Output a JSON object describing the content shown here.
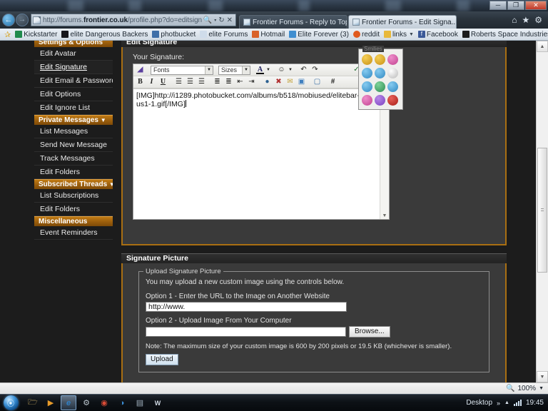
{
  "window": {
    "minimize": "─",
    "restore": "❐",
    "close": "✕"
  },
  "browser": {
    "back_icon": "←",
    "forward_icon": "→",
    "address": {
      "scheme": "http://forums.",
      "domain": "frontier.co.uk",
      "path": "/profile.php?do=editsignature",
      "search_icon": "🔍",
      "dropdown_icon": "▾",
      "refresh_icon": "↻",
      "stop_icon": "✕"
    },
    "tabs": [
      {
        "title": "Frontier Forums - Reply to Topic",
        "active": false
      },
      {
        "title": "Frontier Forums - Edit Signa...",
        "active": true,
        "close": "✕"
      }
    ],
    "toolbar_right": {
      "home_icon": "⌂",
      "favorites_icon": "★",
      "tools_icon": "⚙"
    },
    "bookmarks": [
      {
        "label": "Kickstarter",
        "icon_color": "#1f8a4c",
        "glyph": "K"
      },
      {
        "label": "elite Dangerous Backers",
        "icon_color": "#16161b",
        "glyph": "▼"
      },
      {
        "label": "photbucket",
        "icon_color": "#3f6fa8",
        "glyph": "▣"
      },
      {
        "label": "elite Forums",
        "icon_color": "#cfdcea",
        "glyph": "◨"
      },
      {
        "label": "Hotmail",
        "icon_color": "#d9622a",
        "glyph": "✉"
      },
      {
        "label": "Elite Forever (3)",
        "icon_color": "#3f8ed0",
        "glyph": "e"
      },
      {
        "label": "reddit",
        "icon_color": "#e05a1e",
        "glyph": "◉"
      },
      {
        "label": "links",
        "icon_color": "#e8b93c",
        "glyph": "▮",
        "has_dropdown": true
      },
      {
        "label": "Facebook",
        "icon_color": "#3b5998",
        "glyph": "f"
      },
      {
        "label": "Roberts Space Industries",
        "icon_color": "#1c1c1c",
        "glyph": "▤"
      }
    ],
    "bookmarks_overflow": "»",
    "favorites_star": "✰"
  },
  "sidebar": {
    "groups": [
      {
        "header": "Settings & Options",
        "caret": "",
        "items": [
          {
            "label": "Edit Avatar",
            "selected": false
          },
          {
            "label": "Edit Signature",
            "selected": true
          },
          {
            "label": "Edit Email & Password",
            "selected": false
          },
          {
            "label": "Edit Options",
            "selected": false
          },
          {
            "label": "Edit Ignore List",
            "selected": false
          }
        ]
      },
      {
        "header": "Private Messages",
        "caret": "▼",
        "items": [
          {
            "label": "List Messages",
            "selected": false
          },
          {
            "label": "Send New Message",
            "selected": false
          },
          {
            "label": "Track Messages",
            "selected": false
          },
          {
            "label": "Edit Folders",
            "selected": false
          }
        ]
      },
      {
        "header": "Subscribed Threads",
        "caret": "▼",
        "items": [
          {
            "label": "List Subscriptions",
            "selected": false
          },
          {
            "label": "Edit Folders",
            "selected": false
          }
        ]
      },
      {
        "header": "Miscellaneous",
        "caret": "",
        "items": [
          {
            "label": "Event Reminders",
            "selected": false
          }
        ]
      }
    ]
  },
  "edit_signature": {
    "block_title": "Edit Signature",
    "label": "Your Signature:",
    "toolbar": {
      "removeformat_icon": "░",
      "fonts_value": "Fonts",
      "sizes_value": "Sizes",
      "fontcolor_letter": "A",
      "smiley_icon": "☺",
      "undo_icon": "↶",
      "redo_icon": "↷",
      "spellcheck_icon": "✓",
      "wrap_icon": "↕",
      "mode_icon": "◢",
      "bold": "B",
      "italic": "I",
      "underline": "U",
      "align_left": "≡",
      "align_center": "≡",
      "align_right": "≡",
      "list_ordered": "≣",
      "list_unordered": "≣",
      "outdent": "⇤",
      "indent": "⇥",
      "link_icon": "🌐",
      "unlink_icon": "✂",
      "email_icon": "✉",
      "image_icon": "🖼",
      "quote_icon": "💬",
      "code_icon": "#",
      "dropdown_arrow": "▾"
    },
    "content": "[IMG]http://i1289.photobucket.com/albums/b518/mobiused/elitebar-mobius1-1.gif[/IMG]",
    "scroll_up": "▲",
    "scroll_down": "▼",
    "smilies": {
      "legend": "Smilies",
      "items": [
        {
          "face": ":)",
          "color1": "#f5cf55",
          "color2": "#c89014"
        },
        {
          "face": ":D",
          "color1": "#f5cf55",
          "color2": "#c89014"
        },
        {
          "face": ":p",
          "color1": "#ee8ecb",
          "color2": "#c2418f"
        },
        {
          "face": ":(",
          "color1": "#86cbf0",
          "color2": "#2f88c2"
        },
        {
          "face": "B)",
          "color1": "#86cbf0",
          "color2": "#2f88c2"
        },
        {
          "face": ":O",
          "color1": "#f0f0f0",
          "color2": "#b8b8b8"
        },
        {
          "face": ";)",
          "color1": "#86cbf0",
          "color2": "#2f88c2"
        },
        {
          "face": ":#",
          "color1": "#7ed39a",
          "color2": "#2d8c52"
        },
        {
          "face": "zz",
          "color1": "#86cbf0",
          "color2": "#2f88c2"
        },
        {
          "face": ">:",
          "color1": "#ee8ecb",
          "color2": "#c2418f"
        },
        {
          "face": ":x",
          "color1": "#b88ae8",
          "color2": "#7a3fc0"
        },
        {
          "face": ":@",
          "color1": "#e8625a",
          "color2": "#a81c16"
        }
      ]
    }
  },
  "signature_picture": {
    "block_title": "Signature Picture",
    "legend": "Upload Signature Picture",
    "intro": "You may upload a new custom image using the controls below.",
    "option1_label": "Option 1 - Enter the URL to the Image on Another Website",
    "option1_value": "http://www.",
    "option2_label": "Option 2 - Upload Image From Your Computer",
    "option2_value": "",
    "browse_button": "Browse...",
    "note": "Note: The maximum size of your custom image is 600 by 200 pixels or 19.5 KB (whichever is smaller).",
    "upload_button": "Upload"
  },
  "statusbar": {
    "zoom_icon": "🔍",
    "zoom_level": "100%",
    "zoom_arrow": "▾"
  },
  "taskbar": {
    "start_glyph": "⊞",
    "items": [
      {
        "name": "windows-explorer",
        "glyph": "🗀",
        "color": "#e5c06a",
        "active": false
      },
      {
        "name": "windows-media-player",
        "glyph": "▶",
        "color": "#e79b2a",
        "active": false
      },
      {
        "name": "internet-explorer",
        "glyph": "e",
        "color": "#2f7fc4",
        "active": true
      },
      {
        "name": "steam",
        "glyph": "⚙",
        "color": "#b9c4cc",
        "active": false
      },
      {
        "name": "google-chrome",
        "glyph": "◉",
        "color": "#d84b36",
        "active": false
      },
      {
        "name": "google-earth",
        "glyph": "◕",
        "color": "#3b8ed6",
        "active": false
      },
      {
        "name": "calculator",
        "glyph": "▤",
        "color": "#9fb0bd",
        "active": false
      },
      {
        "name": "microsoft-word",
        "glyph": "W",
        "color": "#cfd8e2",
        "active": false
      }
    ],
    "show_desktop": "Desktop",
    "overflow": "»",
    "tray_up": "▲",
    "clock": "19:45"
  }
}
